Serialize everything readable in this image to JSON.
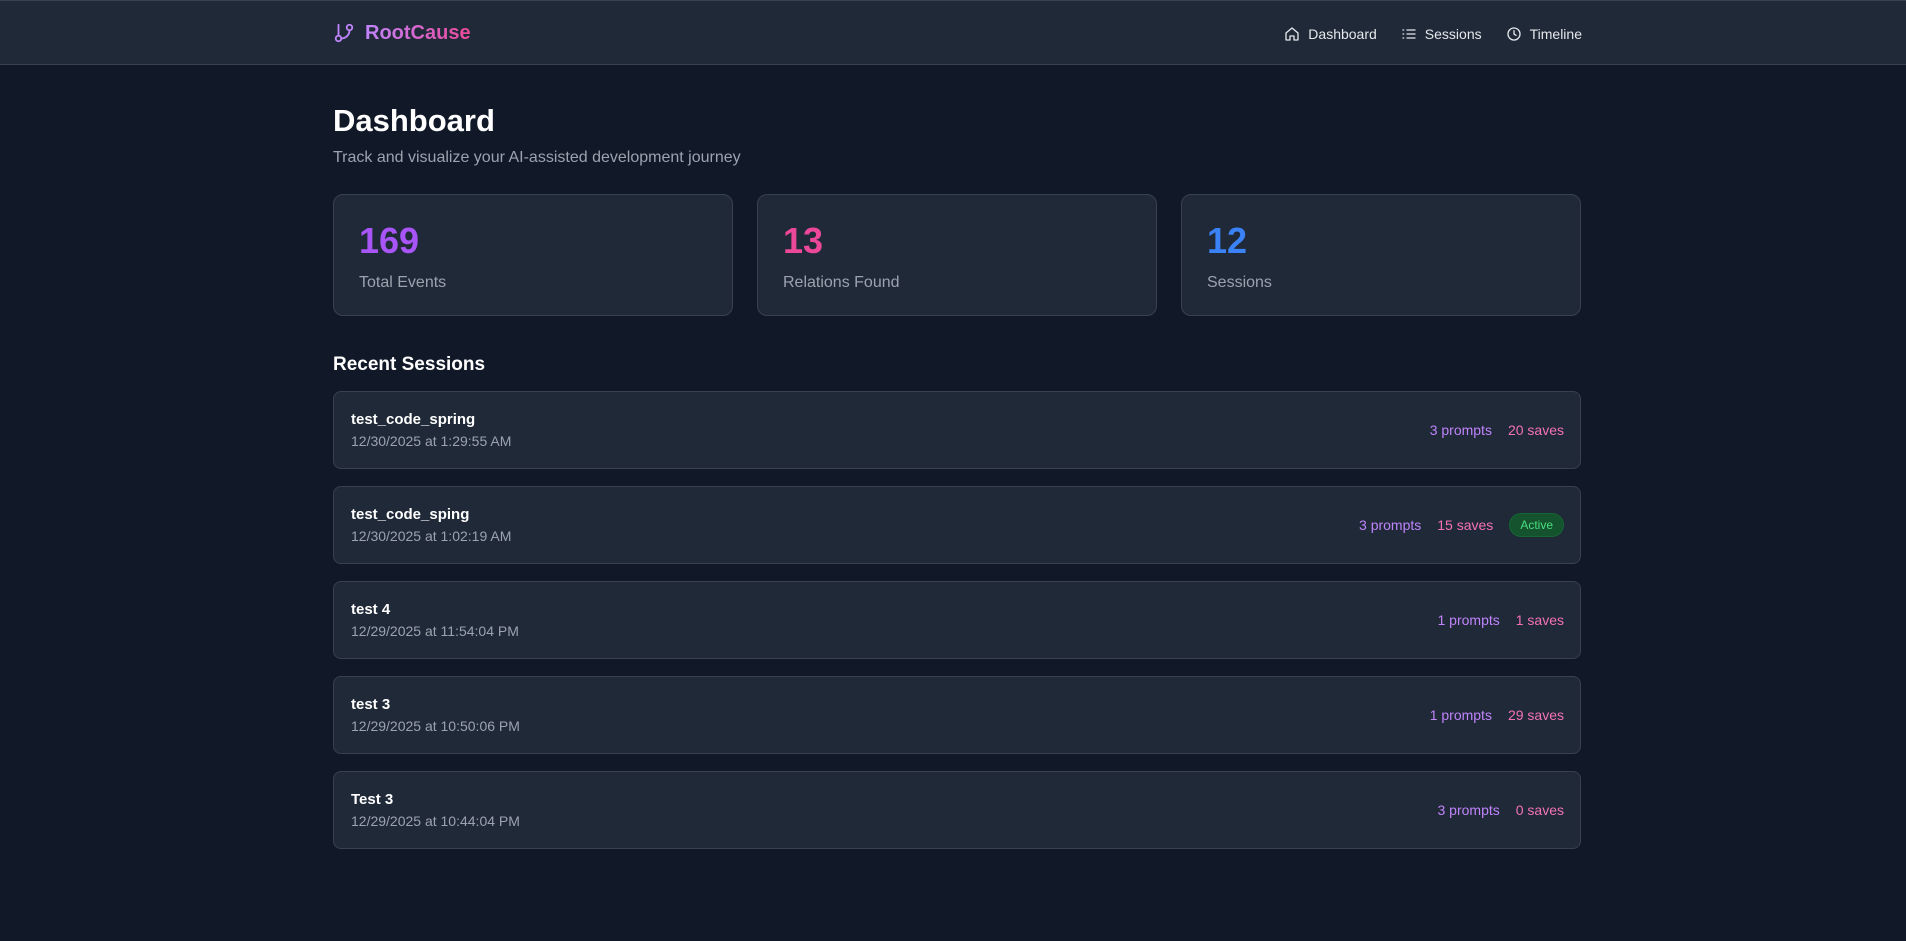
{
  "header": {
    "brand": "RootCause",
    "nav": [
      {
        "label": "Dashboard",
        "icon": "home-icon"
      },
      {
        "label": "Sessions",
        "icon": "list-icon"
      },
      {
        "label": "Timeline",
        "icon": "clock-icon"
      }
    ]
  },
  "page": {
    "title": "Dashboard",
    "subtitle": "Track and visualize your AI-assisted development journey"
  },
  "stats": [
    {
      "value": "169",
      "label": "Total Events",
      "color": "#a855f7"
    },
    {
      "value": "13",
      "label": "Relations Found",
      "color": "#ec4899"
    },
    {
      "value": "12",
      "label": "Sessions",
      "color": "#3b82f6"
    }
  ],
  "recent": {
    "title": "Recent Sessions",
    "sessions": [
      {
        "name": "test_code_spring",
        "date": "12/30/2025 at 1:29:55 AM",
        "prompts": "3 prompts",
        "saves": "20 saves",
        "badge": ""
      },
      {
        "name": "test_code_sping",
        "date": "12/30/2025 at 1:02:19 AM",
        "prompts": "3 prompts",
        "saves": "15 saves",
        "badge": "Active"
      },
      {
        "name": "test 4",
        "date": "12/29/2025 at 11:54:04 PM",
        "prompts": "1 prompts",
        "saves": "1 saves",
        "badge": ""
      },
      {
        "name": "test 3",
        "date": "12/29/2025 at 10:50:06 PM",
        "prompts": "1 prompts",
        "saves": "29 saves",
        "badge": ""
      },
      {
        "name": "Test 3",
        "date": "12/29/2025 at 10:44:04 PM",
        "prompts": "3 prompts",
        "saves": "0 saves",
        "badge": ""
      }
    ]
  },
  "colors": {
    "background": "#111827",
    "surface": "#1f2937",
    "border": "#374151",
    "prompts": "#c084fc",
    "saves": "#f472b6",
    "active": "#4ade80"
  }
}
